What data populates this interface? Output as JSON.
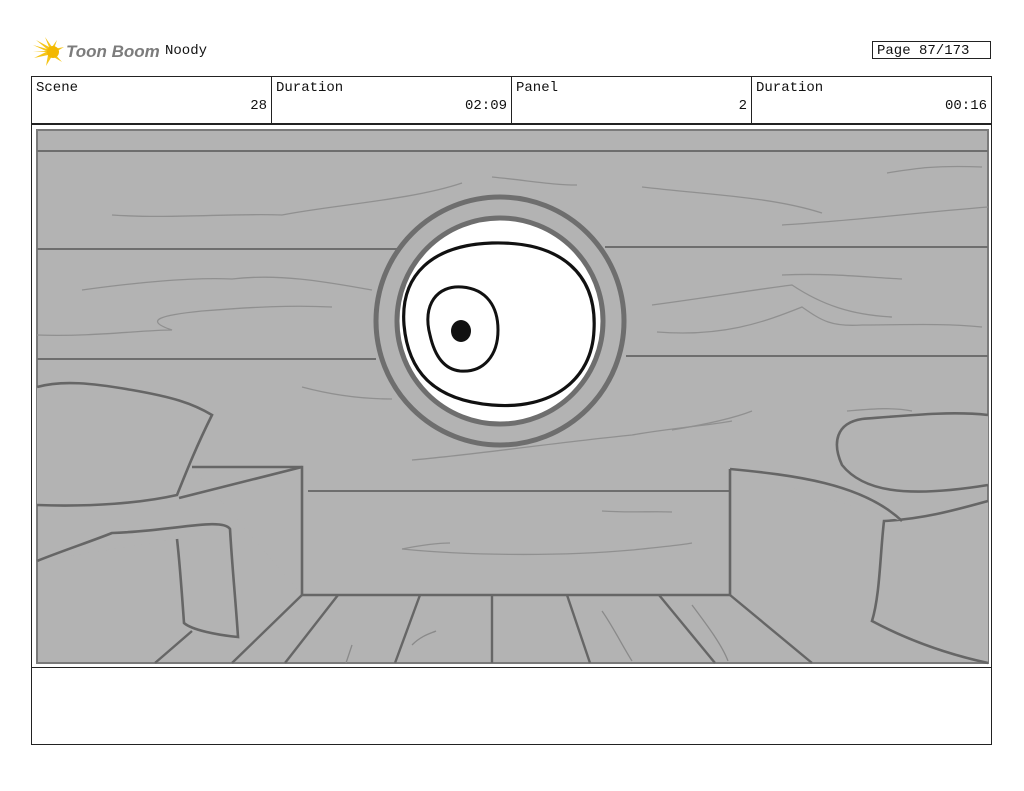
{
  "header": {
    "logo_text": "Toon Boom",
    "project_name": "Noody",
    "page_label": "Page 87/173"
  },
  "info": {
    "scene_label": "Scene",
    "scene_value": "28",
    "scene_duration_label": "Duration",
    "scene_duration_value": "02:09",
    "panel_label": "Panel",
    "panel_value": "2",
    "panel_duration_label": "Duration",
    "panel_duration_value": "00:16"
  },
  "panel": {
    "notes": ""
  }
}
